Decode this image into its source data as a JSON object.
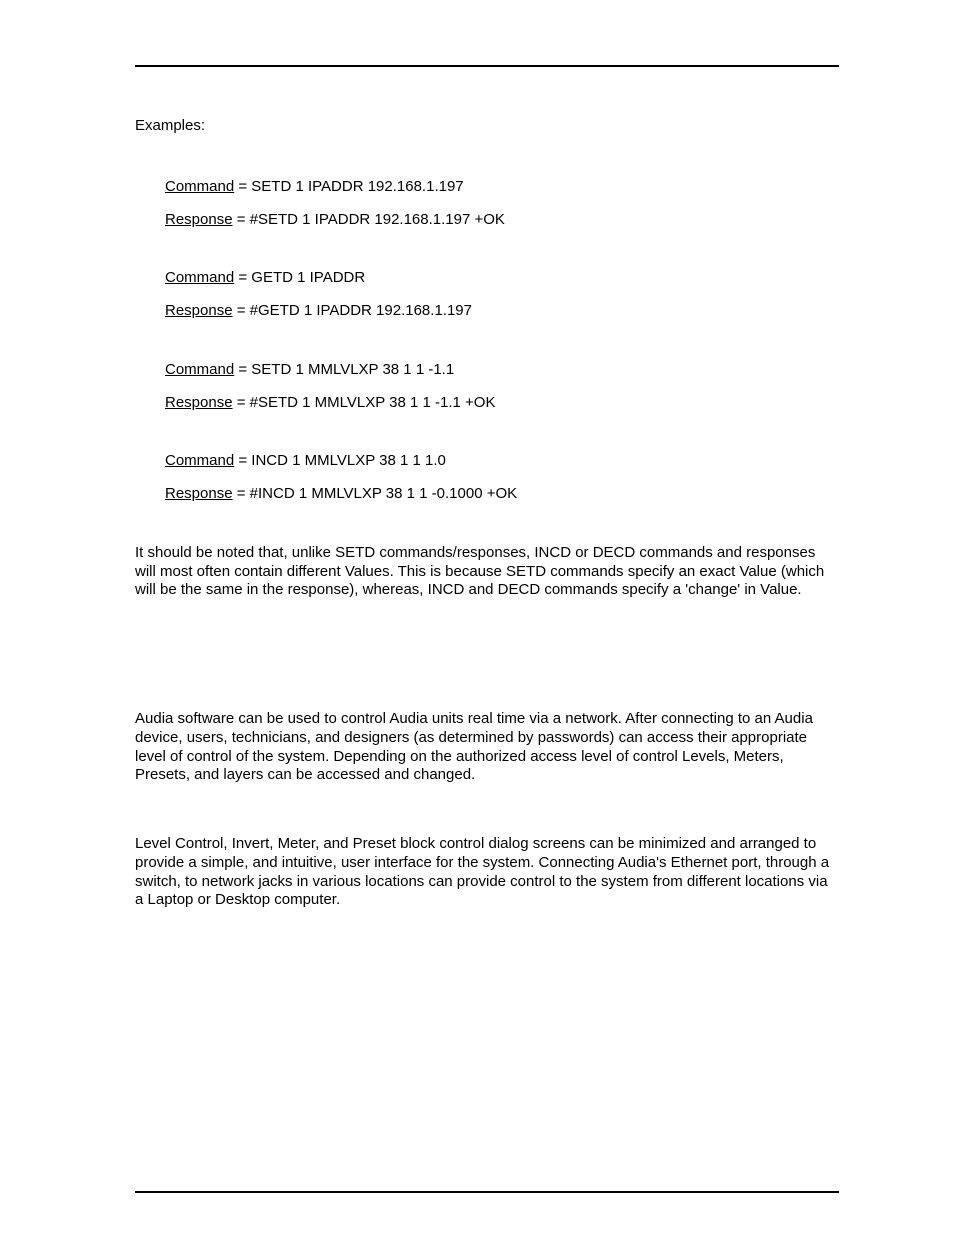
{
  "heading": "Examples:",
  "examples": [
    {
      "command_label": "Command",
      "command_value": " = SETD 1 IPADDR 192.168.1.197",
      "response_label": "Response",
      "response_value": " = #SETD 1 IPADDR 192.168.1.197 +OK"
    },
    {
      "command_label": "Command",
      "command_value": " = GETD 1 IPADDR",
      "response_label": "Response",
      "response_value": " = #GETD 1 IPADDR 192.168.1.197"
    },
    {
      "command_label": "Command",
      "command_value": " = SETD 1 MMLVLXP 38 1 1 -1.1",
      "response_label": "Response",
      "response_value": " = #SETD 1 MMLVLXP 38 1 1 -1.1 +OK"
    },
    {
      "command_label": "Command",
      "command_value": " = INCD 1 MMLVLXP 38 1 1 1.0",
      "response_label": "Response",
      "response_value": " = #INCD 1 MMLVLXP 38 1 1 -0.1000 +OK"
    }
  ],
  "para1": "It should be noted that, unlike SETD commands/responses, INCD or DECD commands and responses will most often contain different Values. This is because SETD commands specify an exact Value (which will be the same in the response), whereas, INCD and DECD commands specify a 'change' in Value.",
  "para2": "Audia software can be used to control Audia units real time via a network. After connecting to an Audia device, users, technicians, and designers (as determined by passwords) can access their appropriate level of control of the system. Depending on the authorized access level of control Levels, Meters, Presets, and layers can be accessed and changed.",
  "para3": "Level Control, Invert, Meter, and Preset block control dialog screens can be minimized and arranged to provide a simple, and intuitive, user interface for the system. Connecting Audia's Ethernet port, through a switch, to network jacks in various locations can provide control to the system from different locations via a Laptop or Desktop computer."
}
